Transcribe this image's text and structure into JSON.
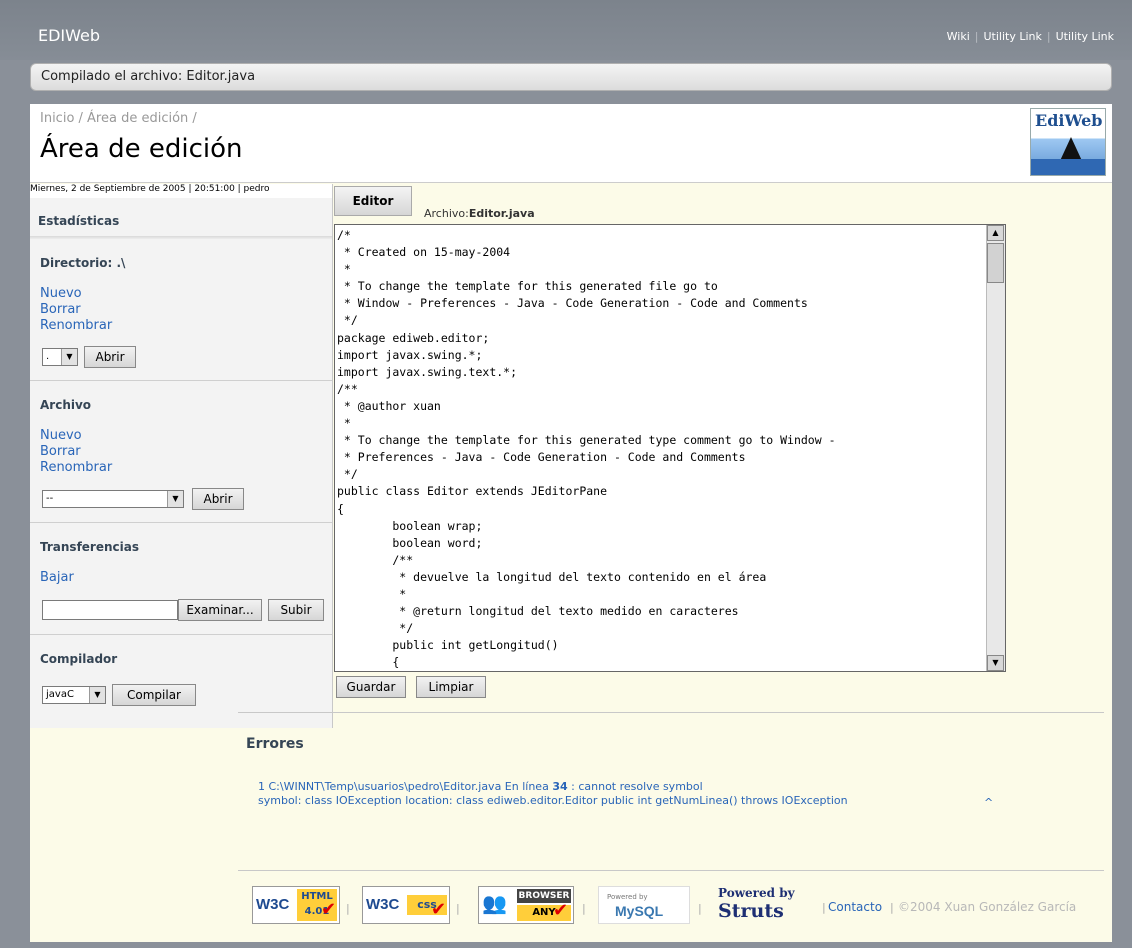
{
  "app": {
    "name": "EDIWeb"
  },
  "utility_links": [
    "Wiki",
    "Utility Link",
    "Utility Link"
  ],
  "message": "Compilado el archivo: Editor.java",
  "breadcrumb": "Inicio / Área de edición /",
  "page_title": "Área de edición",
  "logo_text": "EdiWeb",
  "datebar": "Miernes, 2 de Septiembre de 2005 |  20:51:00  | pedro",
  "sidebar": {
    "stats_title": "Estadísticas",
    "directorio": {
      "title": "Directorio: .\\",
      "links": [
        "Nuevo",
        "Borrar",
        "Renombrar"
      ],
      "select_value": ".",
      "open_label": "Abrir"
    },
    "archivo": {
      "title": "Archivo",
      "links": [
        "Nuevo",
        "Borrar",
        "Renombrar"
      ],
      "select_value": "--",
      "open_label": "Abrir"
    },
    "transferencias": {
      "title": "Transferencias",
      "download_label": "Bajar",
      "browse_label": "Examinar...",
      "upload_label": "Subir"
    },
    "compilador": {
      "title": "Compilador",
      "select_value": "javaC",
      "compile_label": "Compilar"
    }
  },
  "editor": {
    "tab_label": "Editor",
    "file_prefix": "Archivo:",
    "file_name": "Editor.java",
    "code": "/*\n * Created on 15-may-2004\n *\n * To change the template for this generated file go to\n * Window - Preferences - Java - Code Generation - Code and Comments\n */\npackage ediweb.editor;\nimport javax.swing.*;\nimport javax.swing.text.*;\n/**\n * @author xuan\n *\n * To change the template for this generated type comment go to Window -\n * Preferences - Java - Code Generation - Code and Comments\n */\npublic class Editor extends JEditorPane\n{\n        boolean wrap;\n        boolean word;\n        /**\n         * devuelve la longitud del texto contenido en el área\n         *\n         * @return longitud del texto medido en caracteres\n         */\n        public int getLongitud()\n        {",
    "save_label": "Guardar",
    "clear_label": "Limpiar"
  },
  "errors": {
    "title": "Errores",
    "line1_prefix": "1 C:\\WINNT\\Temp\\usuarios\\pedro\\Editor.java En línea",
    "line1_number": "34",
    "line1_suffix": ": cannot resolve symbol",
    "line2": "symbol: class IOException location: class ediweb.editor.Editor public int getNumLinea() throws IOException",
    "caret": "^"
  },
  "footer": {
    "badges": {
      "w3c_html_w3c": "W3C",
      "w3c_html_label": "HTML",
      "w3c_html_version": "4.01",
      "w3c_css_w3c": "W3C",
      "w3c_css_label": "css",
      "browser_top": "BROWSER",
      "browser_bottom": "ANY",
      "mysql_small": "Powered by",
      "mysql_label": "MySQL",
      "struts_small": "Powered by",
      "struts_label": "Struts"
    },
    "contact": "Contacto",
    "copyright": "©2004 Xuan González García"
  },
  "colors": {
    "link": "#2965b8",
    "header_bg": "#858c95",
    "content_bg": "#fcfbe8"
  }
}
